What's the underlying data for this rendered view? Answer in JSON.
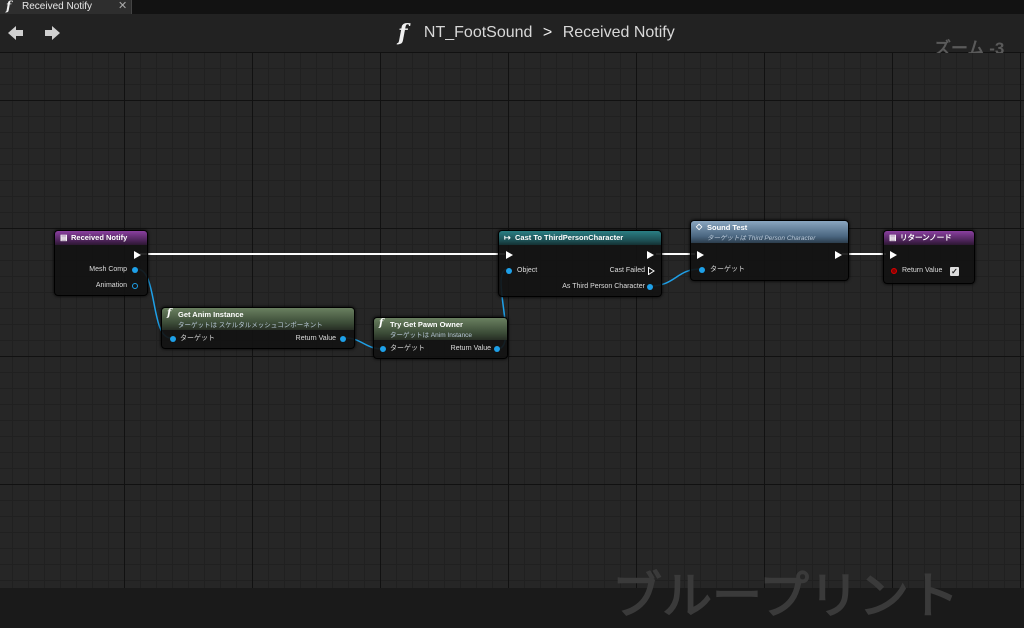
{
  "tab": {
    "icon": "function-icon",
    "label": "Received Notify",
    "close": "✕"
  },
  "header": {
    "breadcrumb": [
      "NT_FootSound",
      "Received Notify"
    ],
    "separator": ">",
    "zoom": "ズーム -3"
  },
  "watermark": "ブループリント",
  "nodes": {
    "received_notify": {
      "title": "Received Notify",
      "pins": [
        "Mesh Comp",
        "Animation"
      ]
    },
    "get_anim_instance": {
      "title": "Get Anim Instance",
      "subtitle": "ターゲットは スケルタルメッシュコンポーネント",
      "in_pin": "ターゲット",
      "out_pin": "Return Value"
    },
    "try_get_pawn_owner": {
      "title": "Try Get Pawn Owner",
      "subtitle": "ターゲットは Anim Instance",
      "in_pin": "ターゲット",
      "out_pin": "Return Value"
    },
    "cast_to": {
      "title": "Cast To ThirdPersonCharacter",
      "in_pin": "Object",
      "out_pins": [
        "Cast Failed",
        "As Third Person Character"
      ]
    },
    "sound_test": {
      "title": "Sound Test",
      "subtitle": "ターゲットは Third Person Character",
      "in_pin": "ターゲット"
    },
    "return_node": {
      "title": "リターンノード",
      "pin": "Return Value",
      "checked": true
    }
  },
  "colors": {
    "exec": "#ffffff",
    "object_pin": "#1ea0e8",
    "bool_pin": "#cc0000"
  }
}
